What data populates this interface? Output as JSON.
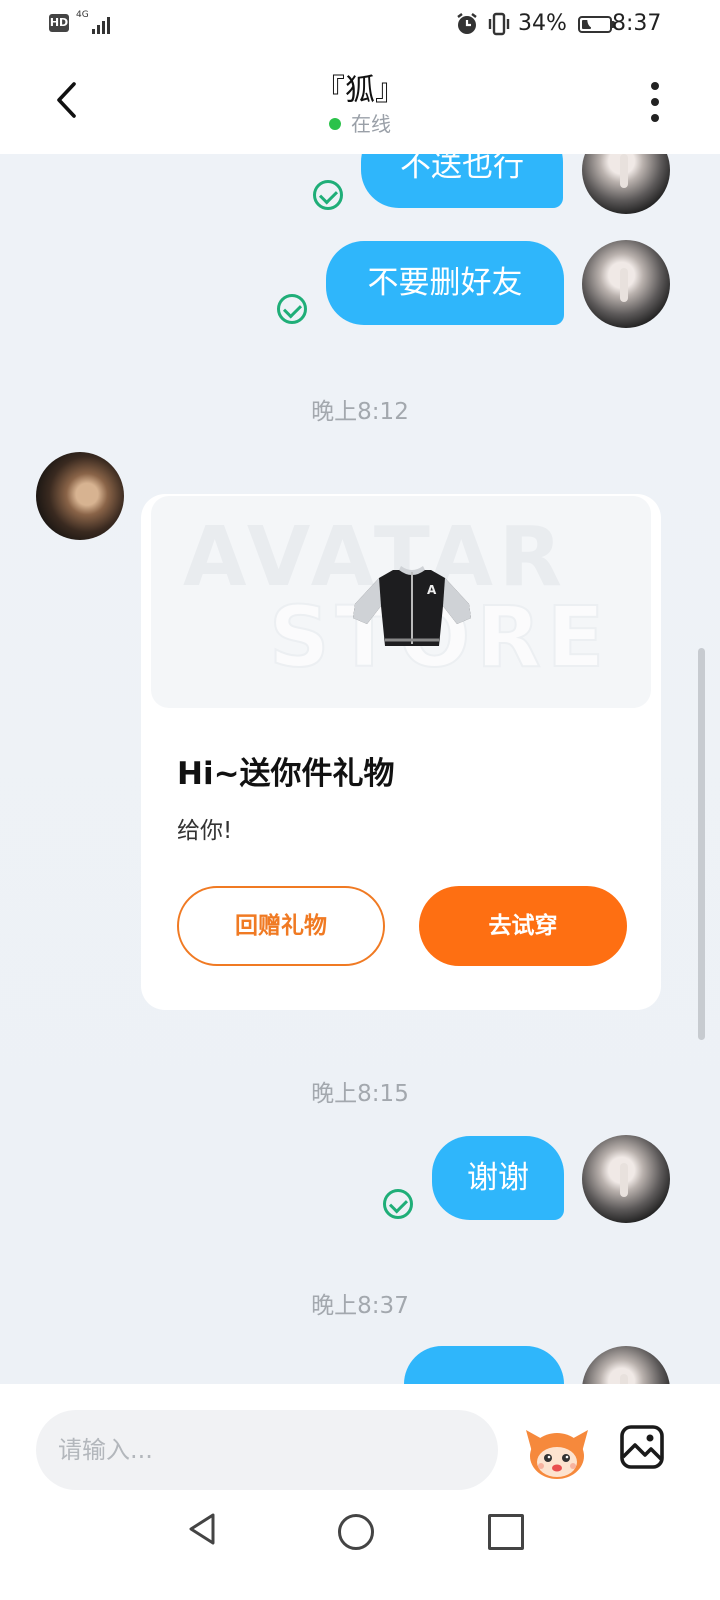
{
  "status_bar": {
    "hd": "HD",
    "network": "4G",
    "battery": "34%",
    "battery_level": 0.34,
    "time": "8:37"
  },
  "header": {
    "title": "『狐』",
    "status": "在线",
    "status_color": "#2bc24a"
  },
  "messages": {
    "top_partial": "不送也行",
    "delete_friend": "不要删好友",
    "time_1": "晚上8:12",
    "gift": {
      "watermark_1": "AVATAR",
      "watermark_2": "STORE",
      "title": "Hi~送你件礼物",
      "description": "给你!",
      "return_gift_label": "回赠礼物",
      "try_on_label": "去试穿"
    },
    "time_2": "晚上8:15",
    "thanks": "谢谢",
    "time_3": "晚上8:37"
  },
  "input": {
    "placeholder": "请输入..."
  },
  "icons": {
    "back": "chevron-left-icon",
    "more": "more-vertical-icon",
    "read": "check-circle-icon",
    "sticker": "mascot-sticker-icon",
    "image": "image-icon",
    "nav_back": "triangle-back-icon",
    "nav_home": "circle-home-icon",
    "nav_recent": "square-recent-icon"
  },
  "colors": {
    "bubble": "#2fb6fb",
    "accent": "#fe6f12",
    "check": "#1fae78"
  }
}
